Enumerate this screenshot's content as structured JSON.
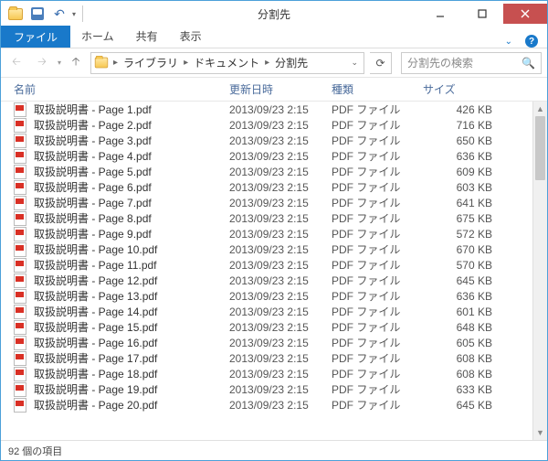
{
  "title": "分割先",
  "ribbon": {
    "file": "ファイル",
    "home": "ホーム",
    "share": "共有",
    "view": "表示"
  },
  "breadcrumb": [
    "ライブラリ",
    "ドキュメント",
    "分割先"
  ],
  "search_placeholder": "分割先の検索",
  "columns": {
    "name": "名前",
    "date": "更新日時",
    "type": "種類",
    "size": "サイズ"
  },
  "files": [
    {
      "name": "取扱説明書 - Page 1.pdf",
      "date": "2013/09/23 2:15",
      "type": "PDF ファイル",
      "size": "426 KB"
    },
    {
      "name": "取扱説明書 - Page 2.pdf",
      "date": "2013/09/23 2:15",
      "type": "PDF ファイル",
      "size": "716 KB"
    },
    {
      "name": "取扱説明書 - Page 3.pdf",
      "date": "2013/09/23 2:15",
      "type": "PDF ファイル",
      "size": "650 KB"
    },
    {
      "name": "取扱説明書 - Page 4.pdf",
      "date": "2013/09/23 2:15",
      "type": "PDF ファイル",
      "size": "636 KB"
    },
    {
      "name": "取扱説明書 - Page 5.pdf",
      "date": "2013/09/23 2:15",
      "type": "PDF ファイル",
      "size": "609 KB"
    },
    {
      "name": "取扱説明書 - Page 6.pdf",
      "date": "2013/09/23 2:15",
      "type": "PDF ファイル",
      "size": "603 KB"
    },
    {
      "name": "取扱説明書 - Page 7.pdf",
      "date": "2013/09/23 2:15",
      "type": "PDF ファイル",
      "size": "641 KB"
    },
    {
      "name": "取扱説明書 - Page 8.pdf",
      "date": "2013/09/23 2:15",
      "type": "PDF ファイル",
      "size": "675 KB"
    },
    {
      "name": "取扱説明書 - Page 9.pdf",
      "date": "2013/09/23 2:15",
      "type": "PDF ファイル",
      "size": "572 KB"
    },
    {
      "name": "取扱説明書 - Page 10.pdf",
      "date": "2013/09/23 2:15",
      "type": "PDF ファイル",
      "size": "670 KB"
    },
    {
      "name": "取扱説明書 - Page 11.pdf",
      "date": "2013/09/23 2:15",
      "type": "PDF ファイル",
      "size": "570 KB"
    },
    {
      "name": "取扱説明書 - Page 12.pdf",
      "date": "2013/09/23 2:15",
      "type": "PDF ファイル",
      "size": "645 KB"
    },
    {
      "name": "取扱説明書 - Page 13.pdf",
      "date": "2013/09/23 2:15",
      "type": "PDF ファイル",
      "size": "636 KB"
    },
    {
      "name": "取扱説明書 - Page 14.pdf",
      "date": "2013/09/23 2:15",
      "type": "PDF ファイル",
      "size": "601 KB"
    },
    {
      "name": "取扱説明書 - Page 15.pdf",
      "date": "2013/09/23 2:15",
      "type": "PDF ファイル",
      "size": "648 KB"
    },
    {
      "name": "取扱説明書 - Page 16.pdf",
      "date": "2013/09/23 2:15",
      "type": "PDF ファイル",
      "size": "605 KB"
    },
    {
      "name": "取扱説明書 - Page 17.pdf",
      "date": "2013/09/23 2:15",
      "type": "PDF ファイル",
      "size": "608 KB"
    },
    {
      "name": "取扱説明書 - Page 18.pdf",
      "date": "2013/09/23 2:15",
      "type": "PDF ファイル",
      "size": "608 KB"
    },
    {
      "name": "取扱説明書 - Page 19.pdf",
      "date": "2013/09/23 2:15",
      "type": "PDF ファイル",
      "size": "633 KB"
    },
    {
      "name": "取扱説明書 - Page 20.pdf",
      "date": "2013/09/23 2:15",
      "type": "PDF ファイル",
      "size": "645 KB"
    }
  ],
  "status": "92 個の項目"
}
